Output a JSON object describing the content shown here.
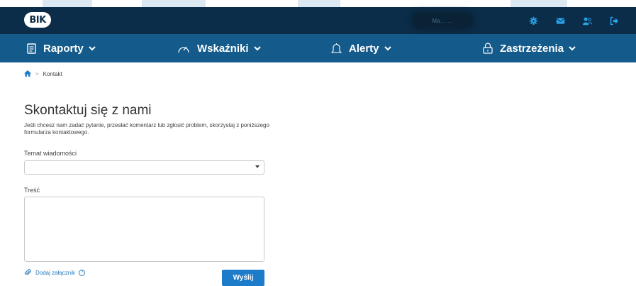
{
  "colors": {
    "topbar": "#0b2d4a",
    "nav": "#145a8a",
    "accent": "#1d7cc9",
    "link": "#2a7bbf"
  },
  "header": {
    "logo_text": "BIK",
    "user_name": "Ma… …",
    "icons": [
      "gear-icon",
      "envelope-icon",
      "users-icon",
      "logout-icon"
    ]
  },
  "nav": {
    "items": [
      {
        "label": "Raporty",
        "icon": "document-icon"
      },
      {
        "label": "Wskaźniki",
        "icon": "gauge-icon"
      },
      {
        "label": "Alerty",
        "icon": "bell-icon"
      },
      {
        "label": "Zastrzeżenia",
        "icon": "lock-icon"
      }
    ]
  },
  "breadcrumb": {
    "home_icon": "home-icon",
    "separator": ">",
    "current": "Kontakt"
  },
  "main": {
    "title": "Skontaktuj się z nami",
    "intro": "Jeśli chcesz nam zadać pytanie, przesłać komentarz lub zgłosić problem, skorzystaj z poniższego formularza kontaktowego.",
    "topic_label": "Temat wiadomości",
    "topic_value": "",
    "body_label": "Treść",
    "body_value": "",
    "attach_label": "Dodaj załącznik",
    "help_glyph": "?",
    "send_label": "Wyślij"
  }
}
